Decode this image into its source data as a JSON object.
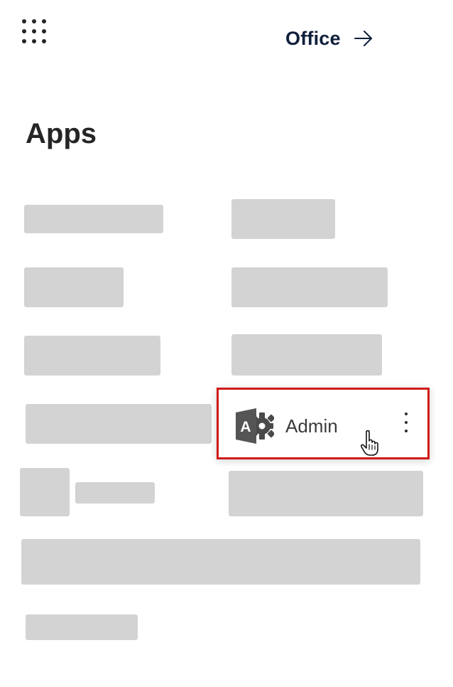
{
  "header": {
    "app_launcher_icon": "waffle-grid-icon",
    "office_label": "Office",
    "office_arrow_icon": "arrow-right-icon"
  },
  "page": {
    "title": "Apps"
  },
  "admin_tile": {
    "icon": "admin-gear-icon",
    "label": "Admin",
    "more_icon": "more-vertical-icon",
    "highlight_color": "#cf1a1a"
  },
  "cursor": {
    "icon": "hand-pointer-icon"
  }
}
